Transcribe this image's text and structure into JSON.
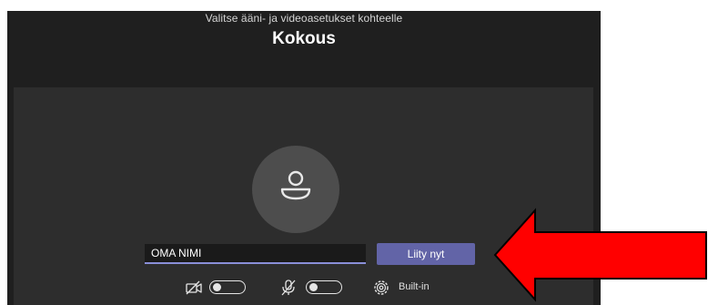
{
  "header": {
    "subtitle": "Valitse ääni- ja videoasetukset kohteelle",
    "title": "Kokous"
  },
  "join": {
    "name_value": "OMA NIMI",
    "button_label": "Liity nyt"
  },
  "controls": {
    "camera": {
      "icon": "camera-off-icon",
      "on": false
    },
    "mic": {
      "icon": "mic-off-icon",
      "on": false
    },
    "device": {
      "icon": "gear-icon",
      "label": "Built-in"
    }
  },
  "annotation": {
    "arrow_icon": "red-arrow-icon",
    "arrow_color": "#ff0000"
  },
  "colors": {
    "accent": "#6264a7",
    "window_bg": "#1f1f1f",
    "preview_bg": "#2d2d2d",
    "avatar_bg": "#4d4d4d"
  }
}
